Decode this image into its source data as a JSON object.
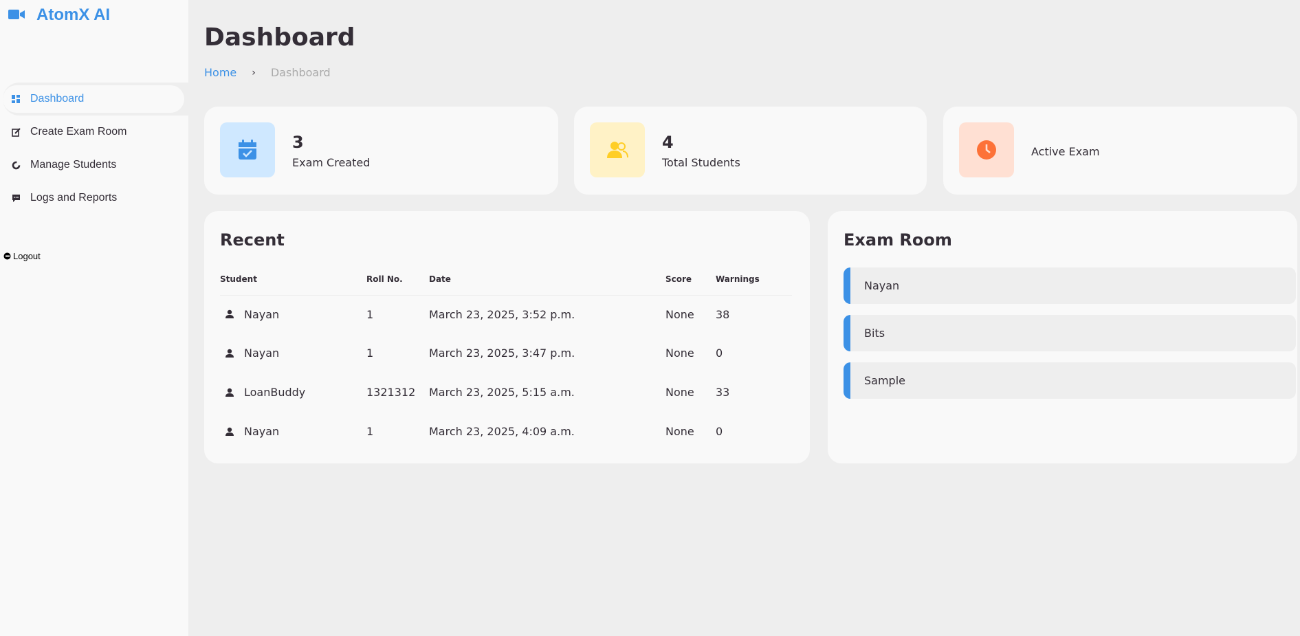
{
  "brand": {
    "name": "AtomX AI",
    "color": "#3c91e6"
  },
  "sidebar": {
    "items": [
      {
        "label": "Dashboard",
        "icon": "dashboard-icon",
        "active": true
      },
      {
        "label": "Create Exam Room",
        "icon": "edit-icon"
      },
      {
        "label": "Manage Students",
        "icon": "pie-icon"
      },
      {
        "label": "Logs and Reports",
        "icon": "message-icon"
      }
    ],
    "logout": {
      "label": "Logout",
      "icon": "logout-icon"
    }
  },
  "header": {
    "title": "Dashboard",
    "breadcrumb": {
      "home": "Home",
      "separator": "›",
      "current": "Dashboard"
    }
  },
  "stats": [
    {
      "value": "3",
      "label": "Exam Created",
      "icon": "calendar-check-icon",
      "bg": "#cfe8ff",
      "color": "#3c91e6"
    },
    {
      "value": "4",
      "label": "Total Students",
      "icon": "group-icon",
      "bg": "#fff2c6",
      "color": "#ffce26"
    },
    {
      "value": "",
      "label": "Active Exam",
      "icon": "clock-icon",
      "bg": "#ffe0d3",
      "color": "#fd7238"
    }
  ],
  "recent": {
    "title": "Recent",
    "columns": [
      "Student",
      "Roll No.",
      "Date",
      "Score",
      "Warnings"
    ],
    "rows": [
      {
        "student": "Nayan",
        "roll": "1",
        "date": "March 23, 2025, 3:52 p.m.",
        "score": "None",
        "warnings": "38"
      },
      {
        "student": "Nayan",
        "roll": "1",
        "date": "March 23, 2025, 3:47 p.m.",
        "score": "None",
        "warnings": "0"
      },
      {
        "student": "LoanBuddy",
        "roll": "1321312",
        "date": "March 23, 2025, 5:15 a.m.",
        "score": "None",
        "warnings": "33"
      },
      {
        "student": "Nayan",
        "roll": "1",
        "date": "March 23, 2025, 4:09 a.m.",
        "score": "None",
        "warnings": "0"
      }
    ]
  },
  "exam_room": {
    "title": "Exam Room",
    "rooms": [
      "Nayan",
      "Bits",
      "Sample"
    ]
  }
}
